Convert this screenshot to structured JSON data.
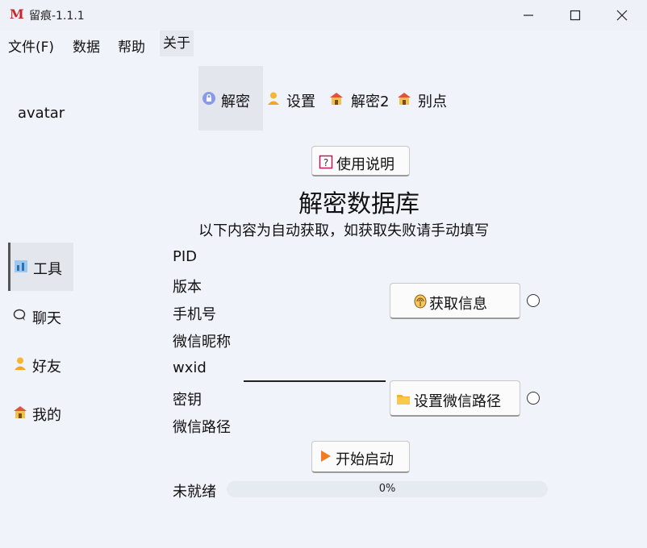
{
  "window": {
    "title": "留痕-1.1.1",
    "app_icon_letter": "M",
    "accent": "#c62828"
  },
  "menu": [
    "文件(F)",
    "数据",
    "帮助",
    "关于"
  ],
  "sidebar": {
    "avatar_label": "avatar",
    "items": [
      {
        "label": "工具",
        "icon": "tools-icon",
        "active": true
      },
      {
        "label": "聊天",
        "icon": "chat-icon",
        "active": false
      },
      {
        "label": "好友",
        "icon": "person-icon",
        "active": false
      },
      {
        "label": "我的",
        "icon": "house-icon",
        "active": false
      }
    ]
  },
  "tabs": [
    {
      "label": "解密",
      "icon": "lock-icon",
      "active": true
    },
    {
      "label": "设置",
      "icon": "person-icon",
      "active": false
    },
    {
      "label": "解密2",
      "icon": "house-icon",
      "active": false
    },
    {
      "label": "别点",
      "icon": "house-icon",
      "active": false
    }
  ],
  "main": {
    "help_button": "使用说明",
    "heading": "解密数据库",
    "subtitle": "以下内容为自动获取，如获取失败请手动填写",
    "fields": [
      "PID",
      "版本",
      "手机号",
      "微信昵称",
      "wxid",
      "密钥",
      "微信路径"
    ],
    "wxid_value": "",
    "get_info_button": "获取信息",
    "set_path_button": "设置微信路径",
    "start_button": "开始启动",
    "status": "未就绪",
    "progress_text": "0%",
    "progress_value": 0
  }
}
